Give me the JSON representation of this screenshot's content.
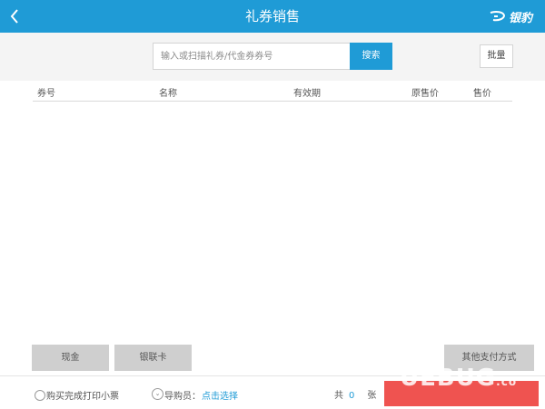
{
  "header": {
    "title": "礼券销售",
    "brand": "银豹"
  },
  "search": {
    "placeholder": "输入或扫描礼券/代金券券号",
    "value": "",
    "button": "搜索",
    "batch_button": "批量"
  },
  "table": {
    "columns": [
      "券号",
      "名称",
      "有效期",
      "原售价",
      "售价"
    ],
    "rows": []
  },
  "payments": {
    "cash": "现金",
    "unionpay": "银联卡",
    "other": "其他支付方式"
  },
  "footer": {
    "print_option": "购买完成打印小票",
    "guide_label": "导购员：",
    "guide_link": "点击选择",
    "count_prefix": "共",
    "count": "0",
    "count_unit": "张"
  },
  "watermark": {
    "text": "UEBUG",
    "suffix": ".co"
  },
  "colors": {
    "primary": "#1f9bd6",
    "checkout": "#ef5350",
    "button_gray": "#cfcfcf"
  }
}
